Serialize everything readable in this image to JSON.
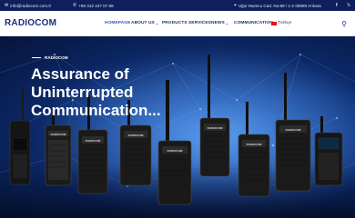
{
  "topbar": {
    "email": "info@radiocom.com.tr",
    "phone": "+90 312 447 07 88",
    "address": "Uğur Mumcu Cad. No:88 / 1-2 06680 Ankara",
    "email_icon": "mail-icon",
    "phone_icon": "phone-icon",
    "address_icon": "map-pin-icon",
    "social": [
      "facebook-icon",
      "x-icon"
    ]
  },
  "header": {
    "logo": "RADIOCOM",
    "nav": [
      {
        "label": "HOMEPAGE",
        "active": true
      },
      {
        "label": "ABOUT US",
        "dropdown": true
      },
      {
        "label": "PRODUCTS"
      },
      {
        "label": "SERVICES"
      },
      {
        "label": "NEWS",
        "dropdown": true
      },
      {
        "label": "COMMUNICATION"
      },
      {
        "label": "Türkçe"
      }
    ],
    "search_icon": "search-icon"
  },
  "hero": {
    "brand": "RADIOCOM",
    "headline_lines": [
      "Assurance of",
      "Uninterrupted",
      "Communication..."
    ],
    "radio_brand": "RADIOCOM"
  },
  "colors": {
    "topbar_bg": "#0e1f5c",
    "nav_text": "#1a2f7a",
    "hero_bg": "#0c2a6b"
  }
}
